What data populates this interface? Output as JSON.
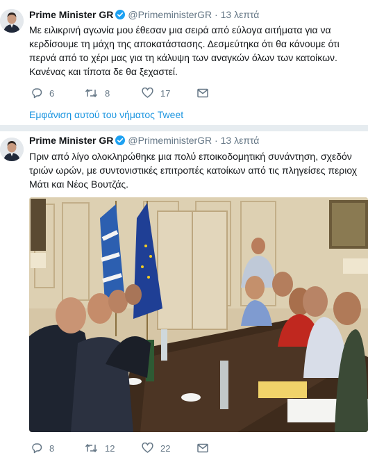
{
  "tweets": [
    {
      "name": "Prime Minister GR",
      "handle": "@PrimeministerGR",
      "separator": "·",
      "time": "13 λεπτά",
      "lines": [
        "Με ειλικρινή αγωνία μου έθεσαν μια σειρά από εύλογα αιτήματα για να",
        "κερδίσουμε τη μάχη της αποκατάστασης. Δεσμεύτηκα ότι θα κάνουμε ότι",
        "περνά από το χέρι μας για τη κάλυψη των αναγκών όλων των κατοίκων.",
        "Κανένας και τίποτα δε θα ξεχαστεί."
      ],
      "replies": "6",
      "retweets": "8",
      "likes": "17",
      "thread_link": "Εμφάνιση αυτού του νήματος Tweet"
    },
    {
      "name": "Prime Minister GR",
      "handle": "@PrimeministerGR",
      "separator": "·",
      "time": "13 λεπτά",
      "lines": [
        "Πριν από λίγο ολοκληρώθηκε μια πολύ εποικοδομητική συνάντηση, σχεδόν",
        "τριών ωρών, με συντονιστικές επιτροπές κατοίκων από τις πληγείσες περιοχ",
        "Μάτι και Νέος Βουτζάς."
      ],
      "replies": "8",
      "retweets": "12",
      "likes": "22"
    }
  ],
  "colors": {
    "text": "#14171a",
    "secondary": "#657786",
    "link": "#1b95e0",
    "verified": "#1da1f2",
    "divider": "#e6ecf0"
  },
  "icons": [
    "verified-badge-icon",
    "reply-icon",
    "retweet-icon",
    "like-icon",
    "direct-message-icon"
  ]
}
